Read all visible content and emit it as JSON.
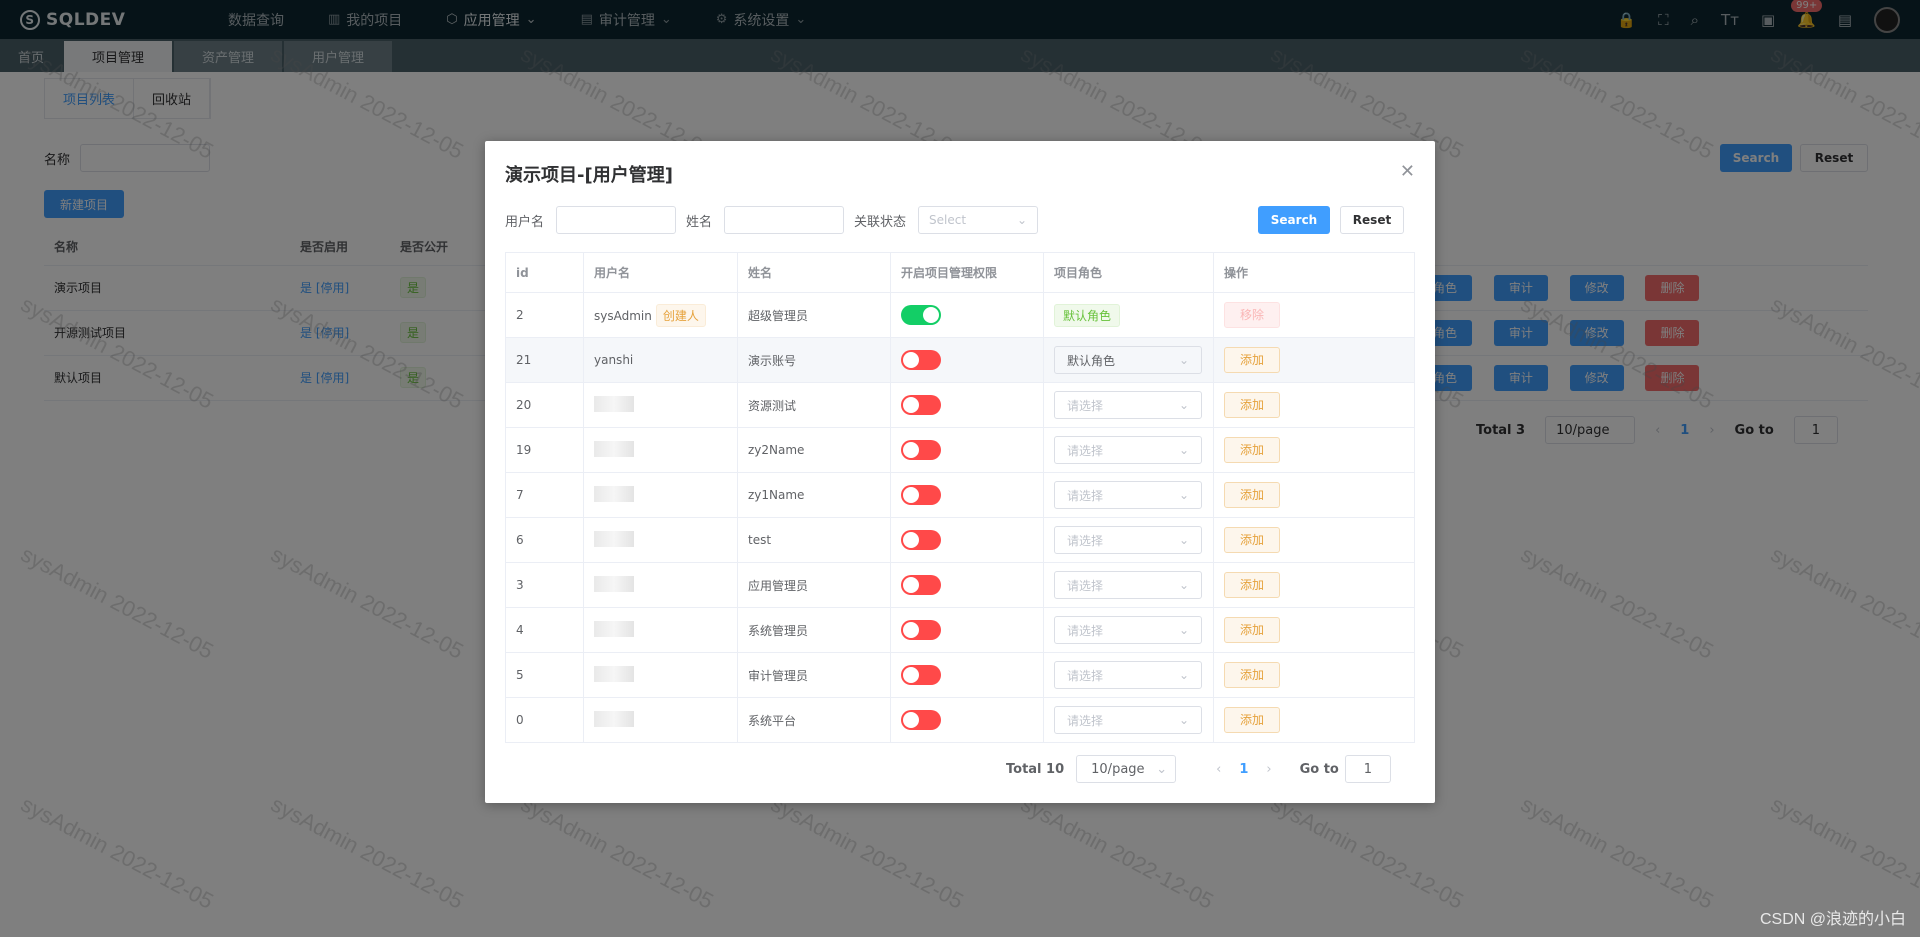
{
  "app": {
    "logo": "SQLDEV",
    "nav": [
      {
        "label": "数据查询",
        "icon": "code-icon"
      },
      {
        "label": "我的项目",
        "icon": "book-icon"
      },
      {
        "label": "应用管理",
        "icon": "cube-icon"
      },
      {
        "label": "审计管理",
        "icon": "audit-icon"
      },
      {
        "label": "系统设置",
        "icon": "gear-icon"
      }
    ],
    "notification_count": "99+"
  },
  "page_tabs": [
    "首页",
    "项目管理",
    "资产管理",
    "用户管理"
  ],
  "background": {
    "subtabs": [
      "项目列表",
      "回收站"
    ],
    "filter_label": "名称",
    "search_label": "Search",
    "reset_label": "Reset",
    "new_label": "新建项目",
    "columns": [
      "名称",
      "是否启用",
      "是否公开"
    ],
    "rows": [
      {
        "name": "演示项目",
        "enabled": "是 [停用]",
        "public": "是"
      },
      {
        "name": "开源测试项目",
        "enabled": "是 [停用]",
        "public": "是"
      },
      {
        "name": "默认项目",
        "enabled": "是 [停用]",
        "public": "是"
      }
    ],
    "op_labels": [
      "角色",
      "审计",
      "修改",
      "删除"
    ],
    "pager": {
      "total": "Total 3",
      "size": "10/page",
      "page": "1",
      "goto": "Go to",
      "goto_value": "1"
    }
  },
  "dialog": {
    "title": "演示项目-[用户管理]",
    "filter": {
      "username_label": "用户名",
      "name_label": "姓名",
      "status_label": "关联状态",
      "status_placeholder": "Select",
      "search_label": "Search",
      "reset_label": "Reset"
    },
    "columns": [
      "id",
      "用户名",
      "姓名",
      "开启项目管理权限",
      "项目角色",
      "操作"
    ],
    "creator_tag": "创建人",
    "default_role_tag": "默认角色",
    "remove_label": "移除",
    "add_label": "添加",
    "role_placeholder": "请选择",
    "rows": [
      {
        "id": "2",
        "username": "sysAdmin",
        "name": "超级管理员",
        "admin": true,
        "role": "默认角色",
        "creator": true
      },
      {
        "id": "21",
        "username": "yanshi",
        "name": "演示账号",
        "admin": false,
        "role": "默认角色",
        "creator": false
      },
      {
        "id": "20",
        "username": "",
        "name": "资源测试",
        "admin": false,
        "role": "",
        "creator": false
      },
      {
        "id": "19",
        "username": "",
        "name": "zy2Name",
        "admin": false,
        "role": "",
        "creator": false
      },
      {
        "id": "7",
        "username": "",
        "name": "zy1Name",
        "admin": false,
        "role": "",
        "creator": false
      },
      {
        "id": "6",
        "username": "",
        "name": "test",
        "admin": false,
        "role": "",
        "creator": false
      },
      {
        "id": "3",
        "username": "",
        "name": "应用管理员",
        "admin": false,
        "role": "",
        "creator": false
      },
      {
        "id": "4",
        "username": "",
        "name": "系统管理员",
        "admin": false,
        "role": "",
        "creator": false
      },
      {
        "id": "5",
        "username": "",
        "name": "审计管理员",
        "admin": false,
        "role": "",
        "creator": false
      },
      {
        "id": "0",
        "username": "",
        "name": "系统平台",
        "admin": false,
        "role": "",
        "creator": false
      }
    ],
    "pager": {
      "total": "Total 10",
      "size": "10/page",
      "page": "1",
      "goto": "Go to",
      "goto_value": "1"
    }
  },
  "watermark": "sysAdmin 2022-12-05",
  "credit": "CSDN @浪迹的小白"
}
